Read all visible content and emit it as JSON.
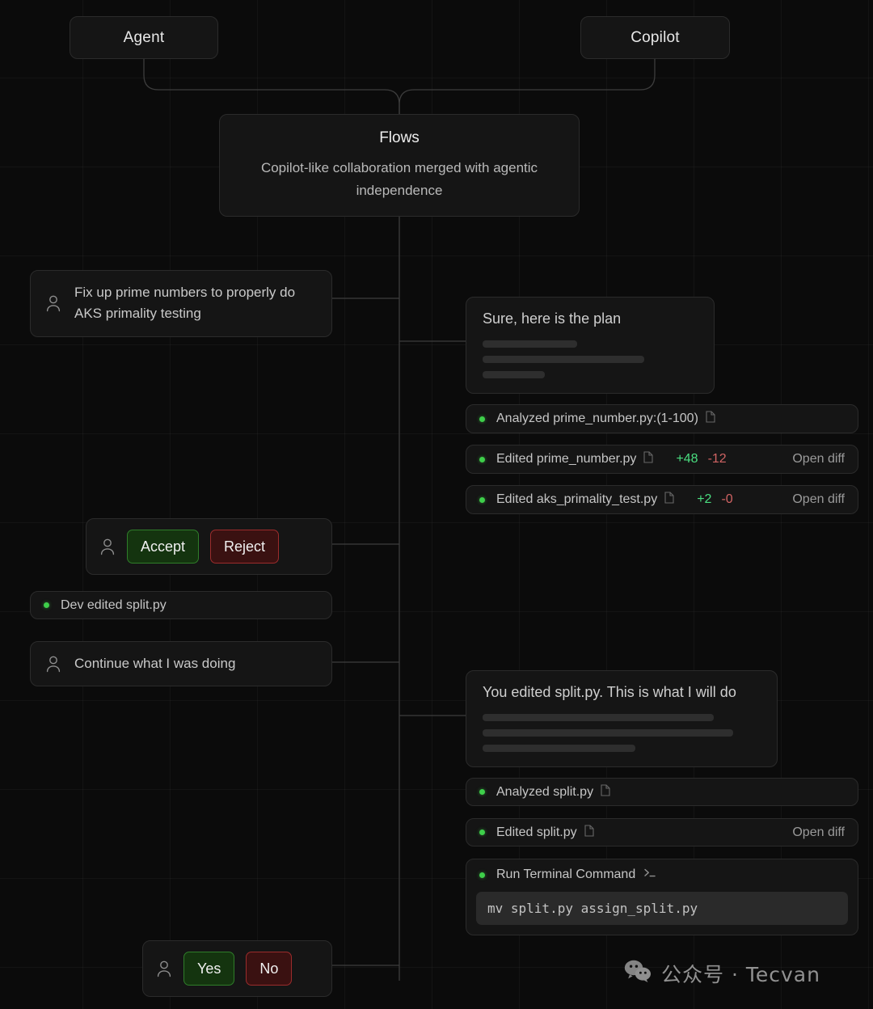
{
  "canvas": {
    "background": "#0b0b0b",
    "grid_color": "rgba(255,255,255,0.035)",
    "edge_color": "#3a3a3a"
  },
  "top_nodes": [
    {
      "id": "agent",
      "label": "Agent"
    },
    {
      "id": "copilot",
      "label": "Copilot"
    }
  ],
  "flows_node": {
    "title": "Flows",
    "subtitle": "Copilot-like collaboration merged with agentic independence"
  },
  "user_prompt_1": {
    "icon": "person-icon",
    "text": "Fix up prime numbers to properly do AKS primality testing"
  },
  "assistant_1": {
    "heading": "Sure, here is the plan",
    "skeleton_widths": [
      "44%",
      "75%",
      "29%"
    ]
  },
  "tool_rows_1": [
    {
      "status": "done",
      "label": "Analyzed prime_number.py:(1-100)",
      "icon": "file-icon",
      "additions": "",
      "deletions": "",
      "action": ""
    },
    {
      "status": "done",
      "label": "Edited prime_number.py",
      "icon": "file-icon",
      "additions": "+48",
      "deletions": "-12",
      "action": "Open diff"
    },
    {
      "status": "done",
      "label": "Edited aks_primality_test.py",
      "icon": "file-icon",
      "additions": "+2",
      "deletions": "-0",
      "action": "Open diff"
    }
  ],
  "approval_1": {
    "icon": "person-icon",
    "buttons": [
      {
        "label": "Accept",
        "style": "green"
      },
      {
        "label": "Reject",
        "style": "red"
      }
    ]
  },
  "dev_event": {
    "status": "done",
    "label": "Dev edited split.py"
  },
  "user_prompt_2": {
    "icon": "person-icon",
    "text": "Continue what I was doing"
  },
  "assistant_2": {
    "heading": "You edited split.py. This is what I will do",
    "skeleton_widths": [
      "83%",
      "90%",
      "55%"
    ]
  },
  "tool_rows_2": [
    {
      "status": "done",
      "label": "Analyzed split.py",
      "icon": "file-icon",
      "additions": "",
      "deletions": "",
      "action": ""
    },
    {
      "status": "done",
      "label": "Edited split.py",
      "icon": "file-icon",
      "additions": "",
      "deletions": "",
      "action": "Open diff"
    }
  ],
  "terminal_card": {
    "status": "done",
    "label": "Run Terminal Command",
    "icon": "terminal-icon",
    "command": "mv split.py assign_split.py"
  },
  "approval_2": {
    "icon": "person-icon",
    "buttons": [
      {
        "label": "Yes",
        "style": "green"
      },
      {
        "label": "No",
        "style": "red"
      }
    ]
  },
  "watermark": {
    "icon": "wechat-icon",
    "text": "公众号 · Tecvan"
  },
  "colors": {
    "status_dot_green": "#3ecf4a",
    "additions_green": "#4ade80",
    "deletions_red": "#d06363",
    "accept_border": "#2f7d2a",
    "reject_border": "#9b2c2c",
    "card_bg": "#151515",
    "card_border": "#2b2b2b"
  }
}
